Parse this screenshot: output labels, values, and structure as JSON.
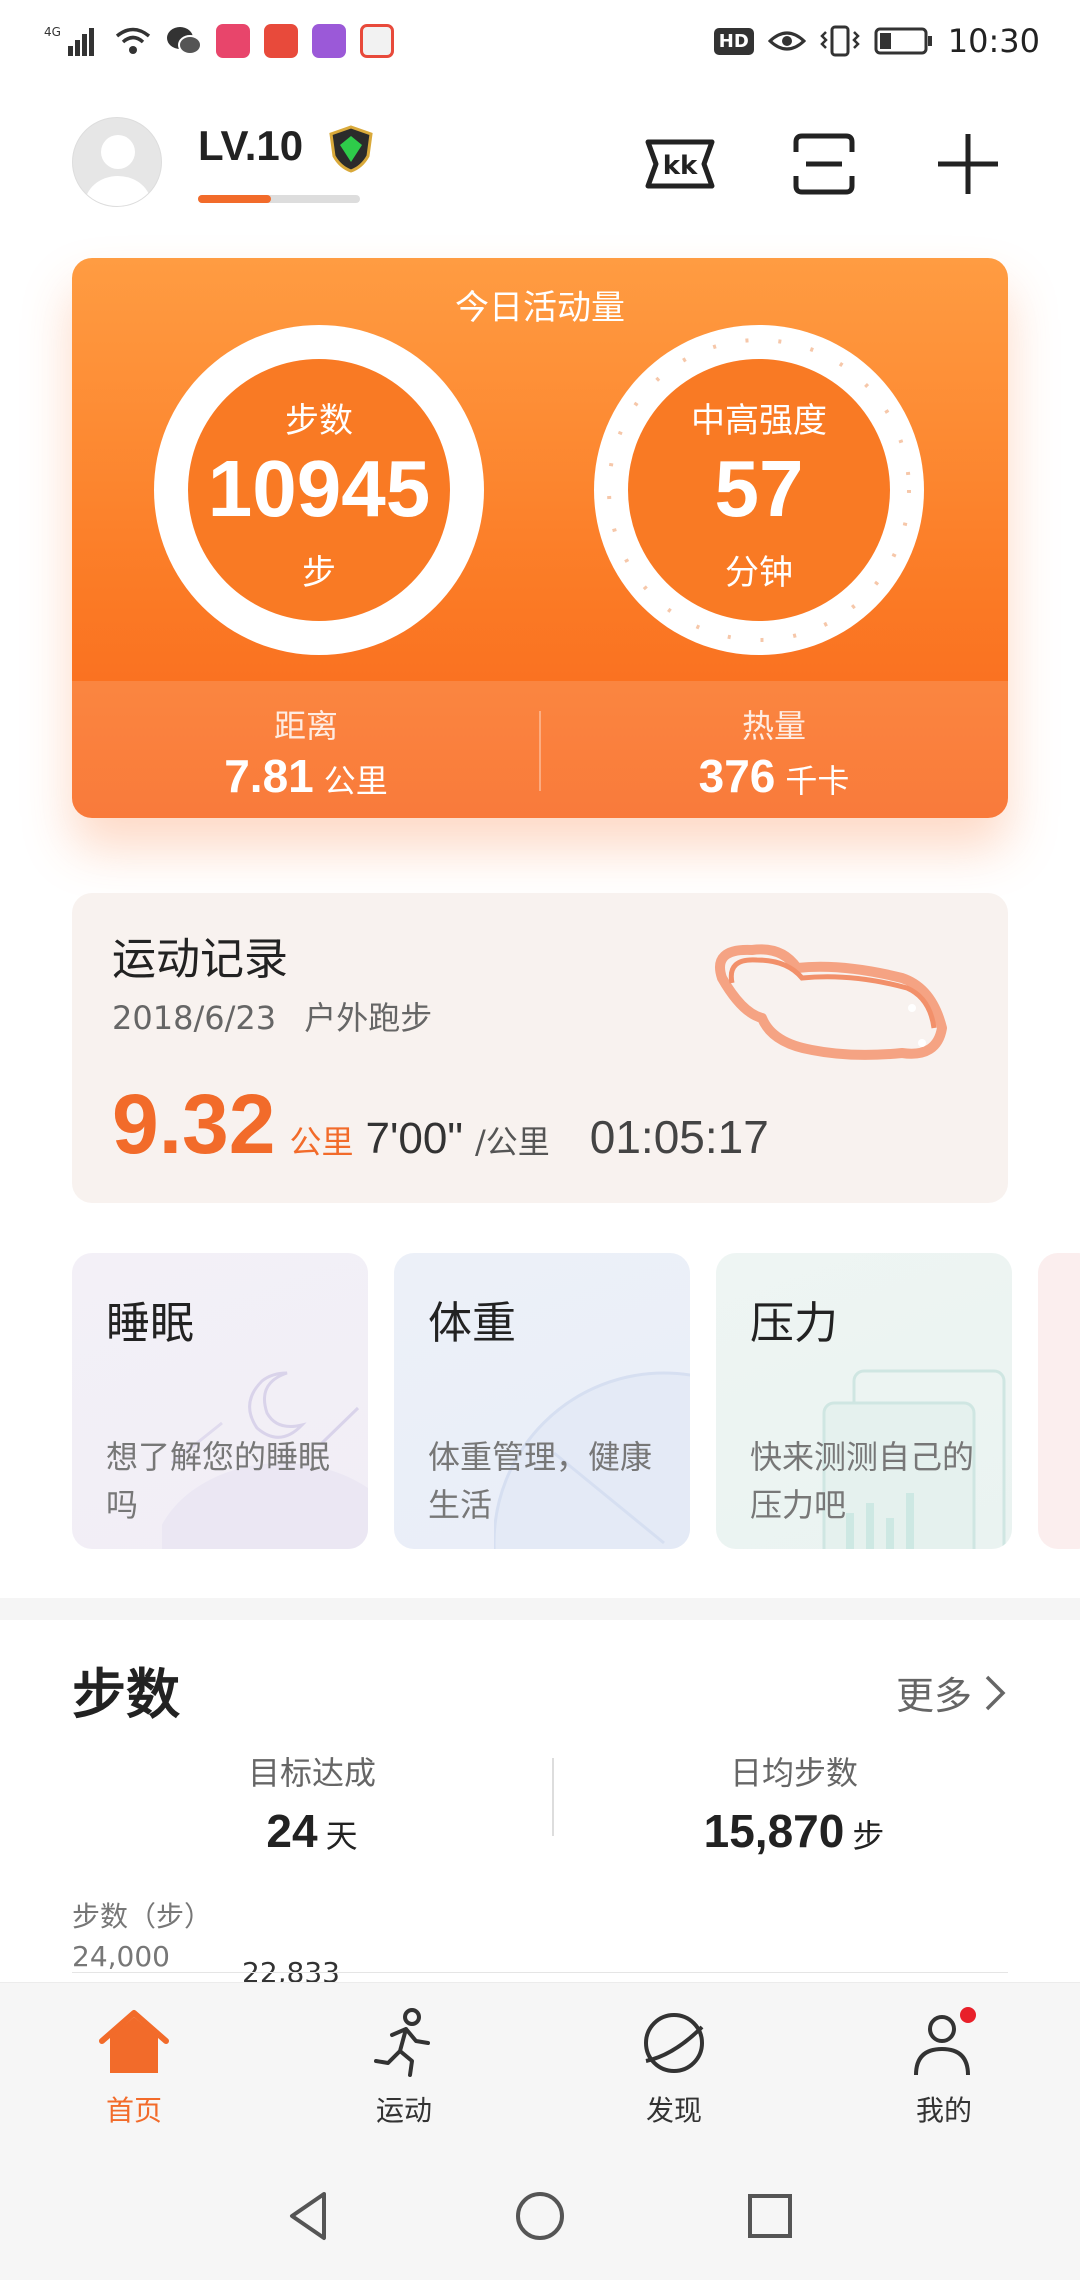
{
  "status_bar": {
    "time": "10:30",
    "network": "4G",
    "hd_label": "HD",
    "icons": [
      "signal-icon",
      "wifi-icon",
      "wechat-icon",
      "eye-icon",
      "vibrate-icon",
      "battery-icon"
    ],
    "battery_level": 0.25
  },
  "header": {
    "level": "LV.10",
    "level_progress": 0.45,
    "icons": [
      "avatar-icon",
      "shield-badge-icon",
      "kk-icon",
      "scan-icon",
      "plus-icon"
    ]
  },
  "activity": {
    "title": "今日活动量",
    "steps": {
      "label": "步数",
      "value": "10945",
      "unit": "步"
    },
    "intensity": {
      "label": "中高强度",
      "value": "57",
      "unit": "分钟"
    },
    "distance": {
      "label": "距离",
      "value": "7.81",
      "unit": "公里"
    },
    "calories": {
      "label": "热量",
      "value": "376",
      "unit": "千卡"
    },
    "colors": {
      "primary": "#f97a24",
      "light": "#ff9c42"
    }
  },
  "record": {
    "title": "运动记录",
    "date": "2018/6/23",
    "type": "户外跑步",
    "distance": "9.32",
    "distance_unit": "公里",
    "pace": "7'00\"",
    "pace_unit": "/公里",
    "duration": "01:05:17"
  },
  "tiles": [
    {
      "title": "睡眠",
      "desc": "想了解您的睡眠吗"
    },
    {
      "title": "体重",
      "desc": "体重管理，健康生活"
    },
    {
      "title": "压力",
      "desc": "快来测测自己的压力吧"
    }
  ],
  "steps_section": {
    "title": "步数",
    "more": "更多",
    "goal_label": "目标达成",
    "goal_value": "24",
    "goal_unit": "天",
    "avg_label": "日均步数",
    "avg_value": "15,870",
    "avg_unit": "步",
    "chart_ylabel": "步数（步）",
    "chart_ytick": "24,000",
    "chart_peak": "22,833"
  },
  "bottom_nav": {
    "items": [
      {
        "label": "首页",
        "active": true,
        "icon": "home-icon"
      },
      {
        "label": "运动",
        "active": false,
        "icon": "running-icon"
      },
      {
        "label": "发现",
        "active": false,
        "icon": "planet-icon"
      },
      {
        "label": "我的",
        "active": false,
        "icon": "profile-icon",
        "badge": true
      }
    ],
    "active_color": "#f26b2a"
  },
  "system_nav": {
    "icons": [
      "back-icon",
      "home-circle-icon",
      "recents-icon"
    ]
  }
}
